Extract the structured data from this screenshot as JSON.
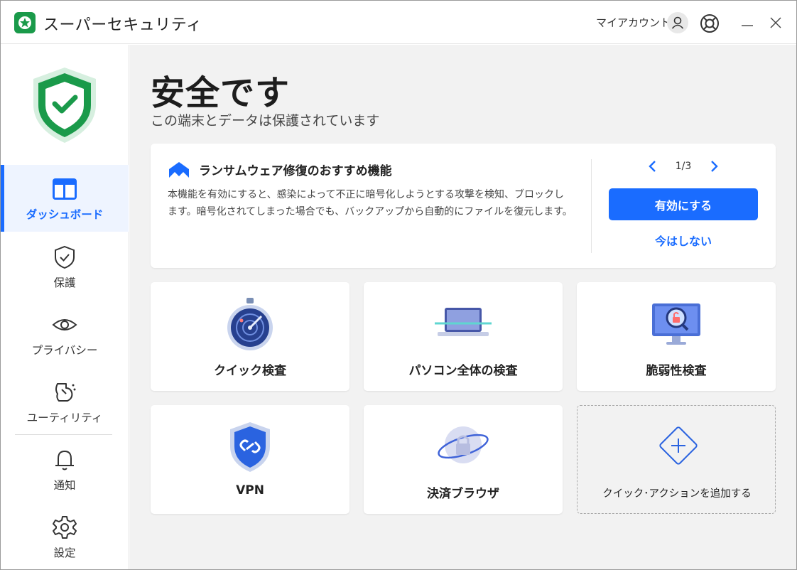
{
  "app": {
    "title": "スーパーセキュリティ",
    "account_label": "マイアカウント"
  },
  "sidebar": {
    "items": [
      {
        "label": "ダッシュボード",
        "icon": "dashboard-icon",
        "active": true
      },
      {
        "label": "保護",
        "icon": "shield-check-icon",
        "active": false
      },
      {
        "label": "プライバシー",
        "icon": "eye-icon",
        "active": false
      },
      {
        "label": "ユーティリティ",
        "icon": "utility-icon",
        "active": false
      },
      {
        "label": "通知",
        "icon": "bell-icon",
        "active": false
      },
      {
        "label": "設定",
        "icon": "gear-icon",
        "active": false
      }
    ]
  },
  "status": {
    "title": "安全です",
    "subtitle": "この端末とデータは保護されています"
  },
  "banner": {
    "title": "ランサムウェア修復のおすすめ機能",
    "text": "本機能を有効にすると、感染によって不正に暗号化しようとする攻撃を検知、ブロックします。暗号化されてしまった場合でも、バックアップから自動的にファイルを復元します。",
    "pager": "1/3",
    "enable_label": "有効にする",
    "later_label": "今はしない"
  },
  "tiles": [
    {
      "label": "クイック検査",
      "icon": "stopwatch-radar-icon"
    },
    {
      "label": "パソコン全体の検査",
      "icon": "laptop-scan-icon"
    },
    {
      "label": "脆弱性検査",
      "icon": "monitor-lock-search-icon"
    },
    {
      "label": "VPN",
      "icon": "vpn-shield-icon"
    },
    {
      "label": "決済ブラウザ",
      "icon": "secure-browser-icon"
    },
    {
      "label": "クイック･アクションを追加する",
      "icon": "plus-diamond-icon"
    }
  ],
  "colors": {
    "accent": "#1a6cff",
    "brand_green": "#1a9a4a",
    "main_bg": "#f2f2f2"
  }
}
